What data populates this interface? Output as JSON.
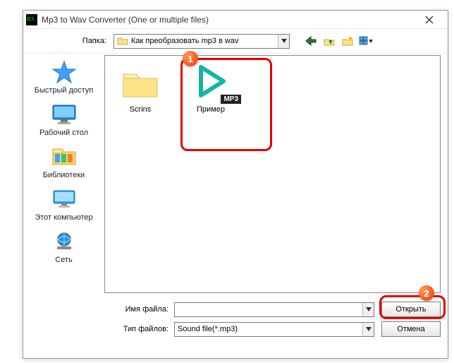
{
  "window": {
    "title": "Mp3 to Wav Converter (One or multiple files)",
    "app_icon_text": "C:\\_"
  },
  "folderbar": {
    "label": "Папка:",
    "value": "Как преобразовать mp3 в wav"
  },
  "toolbar_icons": [
    "back-arrow",
    "up-folder",
    "new-folder",
    "view-menu"
  ],
  "places": [
    {
      "key": "quick-access",
      "label": "Быстрый доступ"
    },
    {
      "key": "desktop",
      "label": "Рабочий стол"
    },
    {
      "key": "libraries",
      "label": "Библиотеки"
    },
    {
      "key": "this-pc",
      "label": "Этот компьютер"
    },
    {
      "key": "network",
      "label": "Сеть"
    }
  ],
  "files": [
    {
      "key": "scrins",
      "type": "folder",
      "label": "Scrins"
    },
    {
      "key": "primer",
      "type": "mp3",
      "label": "Пример",
      "badge_text": "MP3"
    }
  ],
  "bottom": {
    "filename_label": "Имя файла:",
    "filename_value": "",
    "filetype_label": "Тип файлов:",
    "filetype_value": "Sound file(*.mp3)",
    "open_label": "Открыть",
    "cancel_label": "Отмена"
  },
  "annotations": {
    "badge1": "1",
    "badge2": "2"
  }
}
